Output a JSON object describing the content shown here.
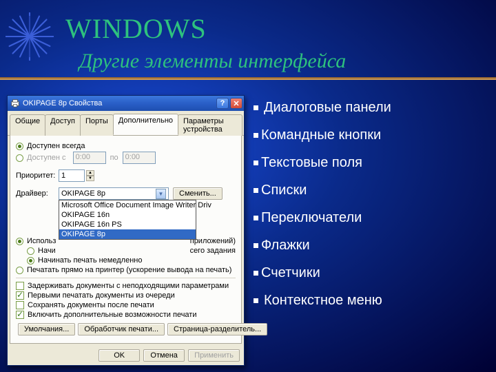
{
  "slide": {
    "title": "WINDOWS",
    "subtitle": "Другие элементы интерфейса",
    "bullets": [
      "Диалоговые панели",
      "Командные кнопки",
      "Текстовые поля",
      "Списки",
      "Переключатели",
      "Флажки",
      "Счетчики",
      "Контекстное меню"
    ]
  },
  "dialog": {
    "title": "OKIPAGE 8p Свойства",
    "tabs": [
      "Общие",
      "Доступ",
      "Порты",
      "Дополнительно",
      "Параметры устройства"
    ],
    "active_tab": 3,
    "radios": {
      "avail_always": "Доступен всегда",
      "avail_from": "Доступен с",
      "spool_use": "Использ",
      "spool_use_suffix": "приложений)",
      "spool_start_after": "Начи",
      "spool_start_after_suffix": "сего задания",
      "spool_start_now": "Начинать печать немедленно",
      "print_direct": "Печатать прямо на принтер (ускорение вывода на печать)"
    },
    "labels": {
      "priority": "Приоритет:",
      "driver": "Драйвер:",
      "po": "по"
    },
    "times": {
      "from": "0:00",
      "to": "0:00"
    },
    "priority_value": "1",
    "driver_value": "OKIPAGE 8p",
    "driver_options": [
      "Microsoft Office Document Image Writer Driv",
      "OKIPAGE 16n",
      "OKIPAGE 16n PS",
      "OKIPAGE 8p"
    ],
    "change_btn": "Сменить...",
    "checkboxes": {
      "hold": "Задерживать документы с неподходящими параметрами",
      "firstq": "Первыми печатать документы из очереди",
      "keep": "Сохранять документы после печати",
      "extra": "Включить дополнительные возможности печати"
    },
    "bottom_buttons": [
      "Умолчания...",
      "Обработчик печати...",
      "Страница-разделитель..."
    ],
    "dialog_buttons": {
      "ok": "OK",
      "cancel": "Отмена",
      "apply": "Применить"
    }
  }
}
